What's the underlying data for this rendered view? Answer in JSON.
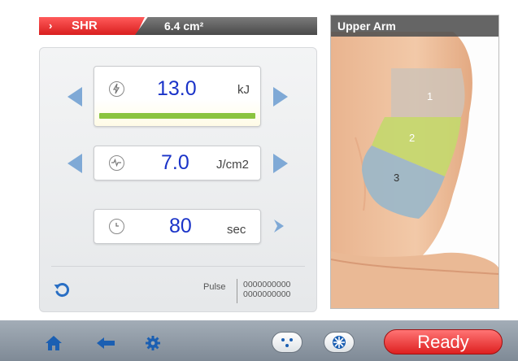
{
  "header": {
    "mode_chevron": "›",
    "mode_label": "SHR",
    "area_value": "6.4 cm²"
  },
  "params": {
    "energy": {
      "value": "13.0",
      "unit": "kJ",
      "icon": "lightning-icon",
      "level": 1.0
    },
    "fluence": {
      "value": "7.0",
      "unit": "J/cm2",
      "icon": "pulse-wave-icon"
    },
    "time": {
      "value": "80",
      "unit": "sec",
      "icon": "clock-icon"
    }
  },
  "pulse": {
    "label": "Pulse",
    "line1": "0000000000",
    "line2": "0000000000"
  },
  "body_panel": {
    "title": "Upper Arm",
    "zones": [
      "1",
      "2",
      "3"
    ]
  },
  "footer": {
    "ready_label": "Ready",
    "icons": [
      "home-icon",
      "back-arrow-icon",
      "settings-gear-icon",
      "dots-icon",
      "fan-icon"
    ]
  },
  "colors": {
    "accent_red": "#e23030",
    "value_blue": "#1a33c8",
    "arrow_blue": "#7fa9d6",
    "energy_bar": "#8ac43f",
    "zone1": "#cfc3b6",
    "zone2": "#c4d86e",
    "zone3": "#9bb7c9"
  }
}
